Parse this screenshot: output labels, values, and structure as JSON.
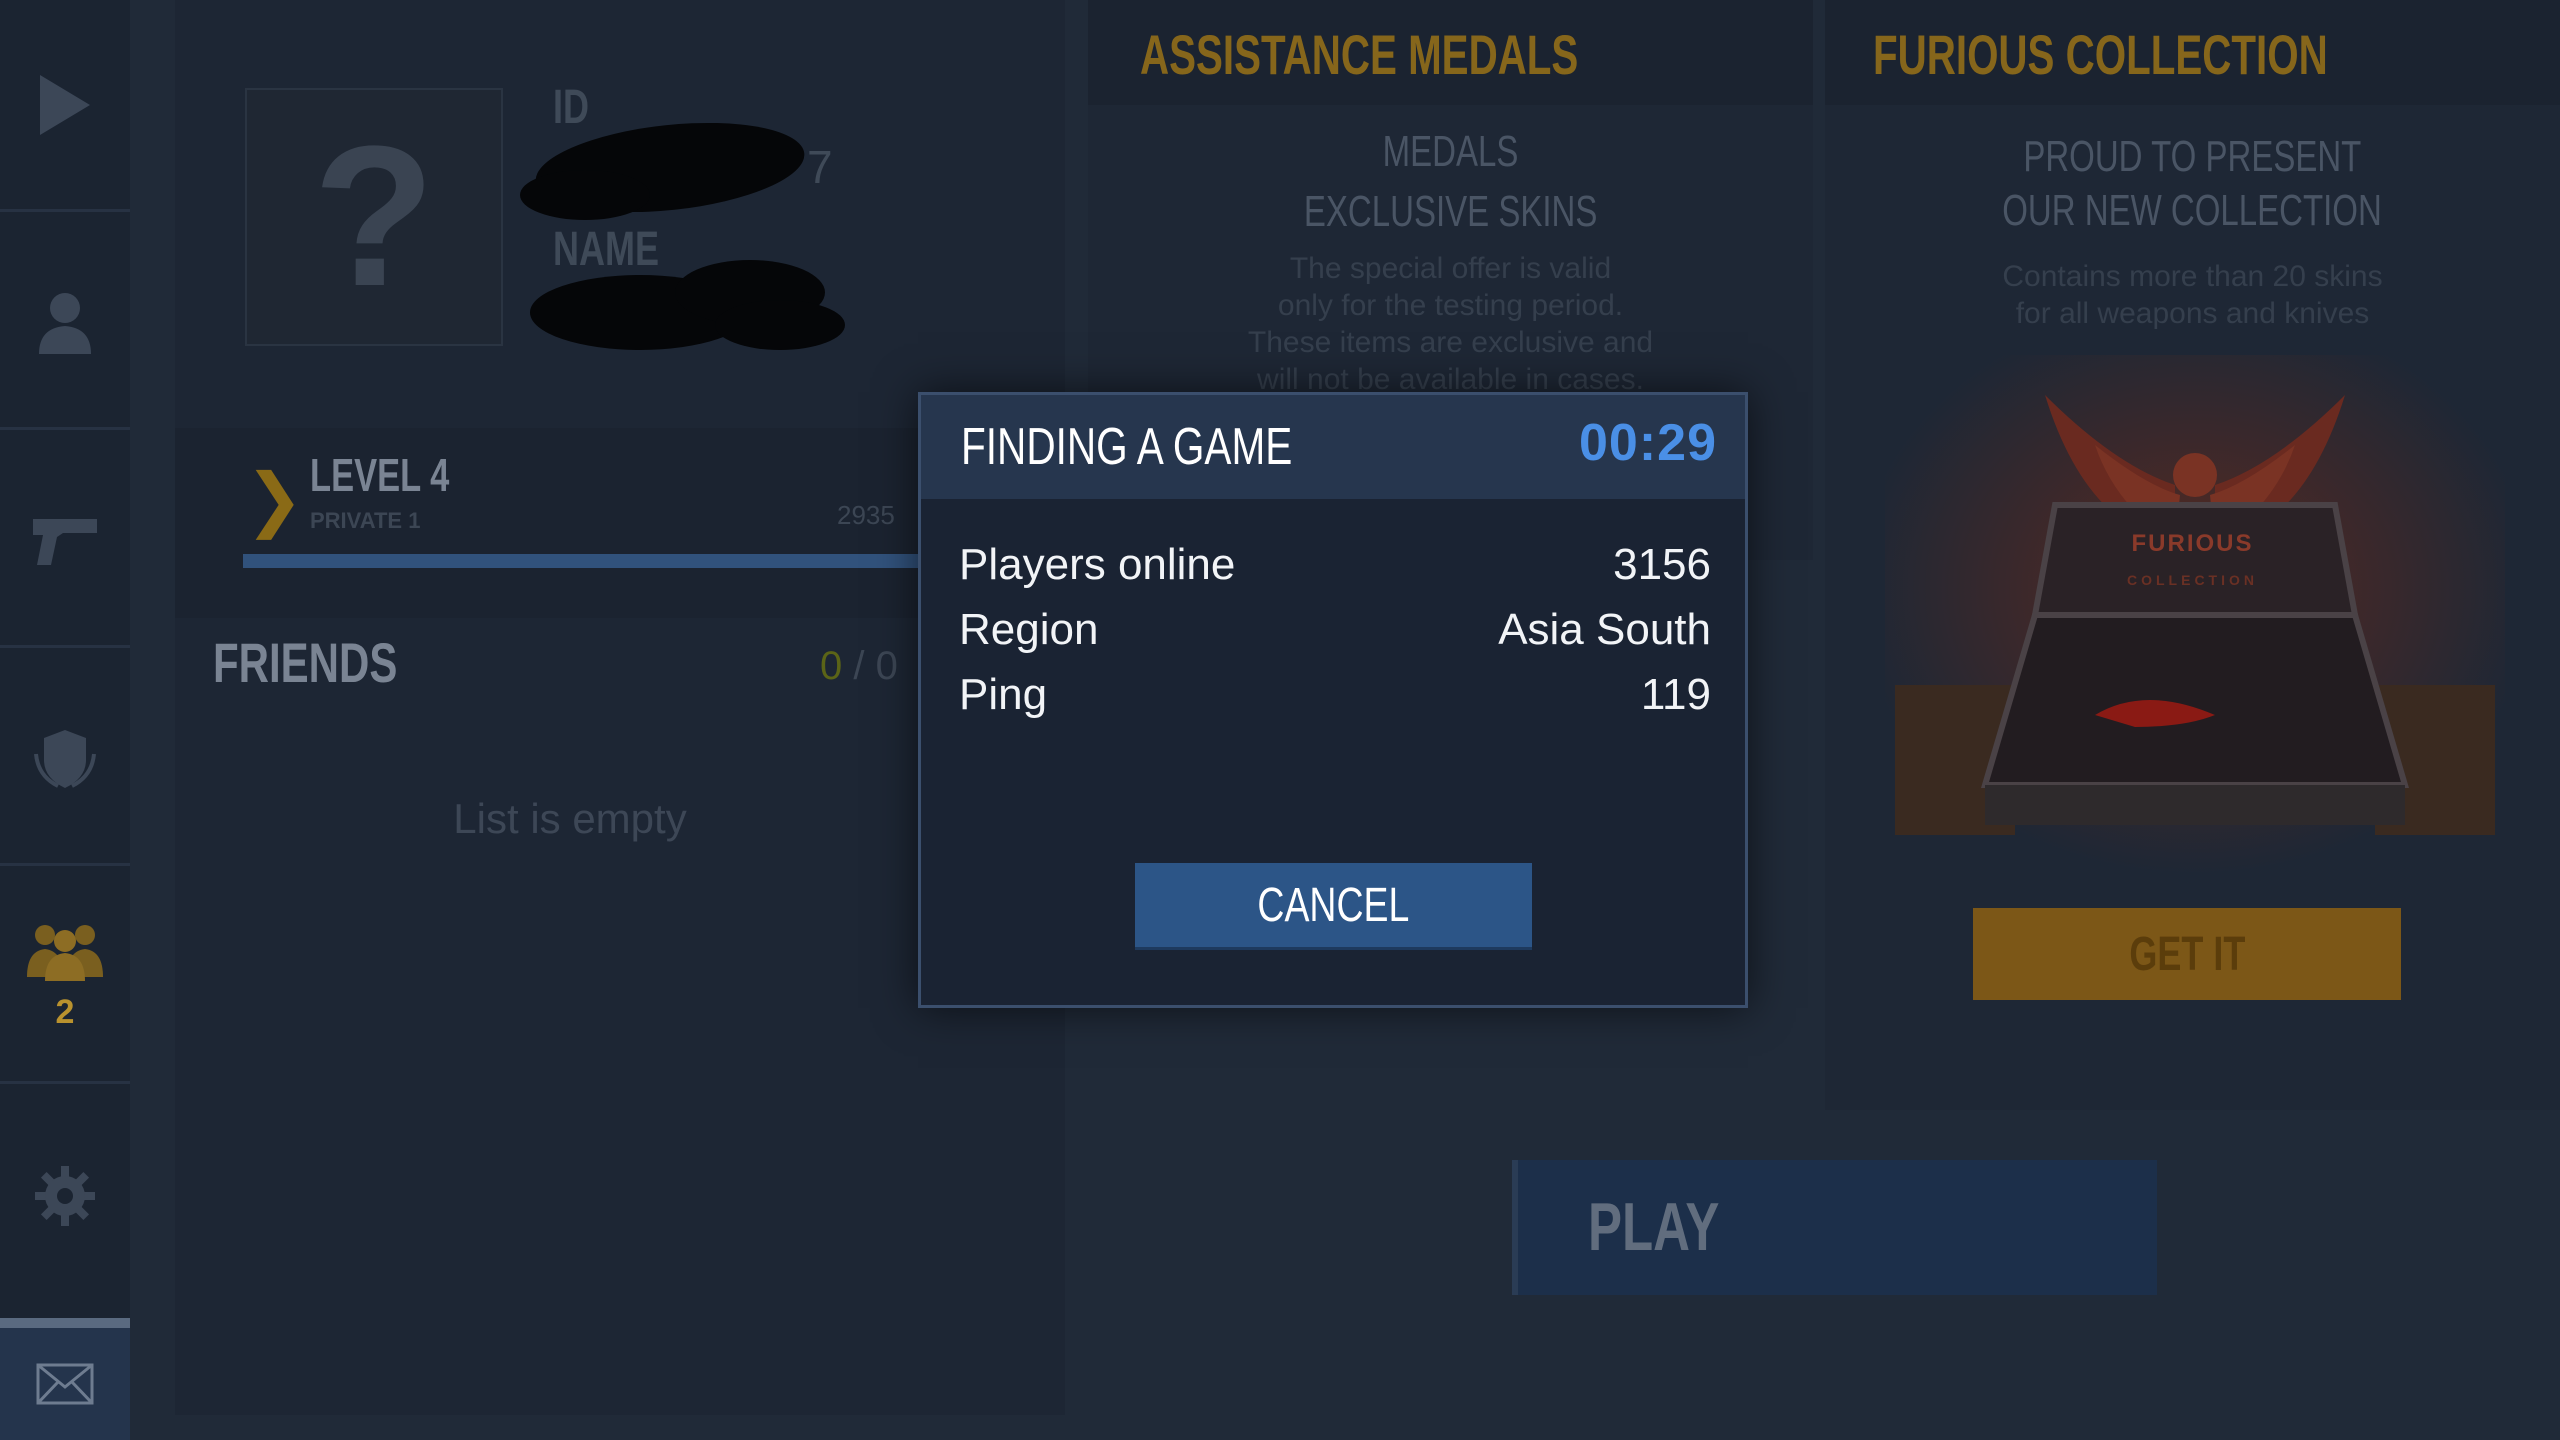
{
  "sidebar": {
    "icons": [
      "play-icon",
      "user-icon",
      "pistol-icon",
      "shield-icon",
      "clan-icon",
      "gear-icon",
      "mail-icon"
    ],
    "clan_badge": "2"
  },
  "profile": {
    "id_label": "ID",
    "name_label": "NAME",
    "avatar_symbol": "?",
    "level_chevron": "❯",
    "level": "LEVEL 4",
    "rank": "PRIVATE 1",
    "xp": "2935",
    "xp_progress": 0.92
  },
  "friends": {
    "title": "FRIENDS",
    "online": "0",
    "separator": "/",
    "total": "0",
    "empty_text": "List is empty"
  },
  "medals": {
    "title": "ASSISTANCE MEDALS",
    "heading_1": "MEDALS",
    "heading_2": "EXCLUSIVE SKINS",
    "text_1": "The special offer is valid",
    "text_2": "only for the testing period.",
    "text_3": "These items are exclusive and",
    "text_4": "will not be available in cases."
  },
  "collection": {
    "title": "FURIOUS COLLECTION",
    "heading_1": "PROUD TO PRESENT",
    "heading_2": "OUR NEW COLLECTION",
    "text_1": "Contains more than 20 skins",
    "text_2": "for all weapons and knives",
    "logo_text": "FURIOUS",
    "logo_sub": "COLLECTION",
    "button": "GET IT"
  },
  "play": {
    "label": "PLAY"
  },
  "dialog": {
    "title": "FINDING A GAME",
    "timer": "00:29",
    "rows": [
      {
        "label": "Players online",
        "value": "3156"
      },
      {
        "label": "Region",
        "value": "Asia South"
      },
      {
        "label": "Ping",
        "value": "119"
      }
    ],
    "cancel": "CANCEL"
  },
  "colors": {
    "accent_blue": "#4a8fe6",
    "button_blue": "#2c5587",
    "gold": "#86661b"
  }
}
